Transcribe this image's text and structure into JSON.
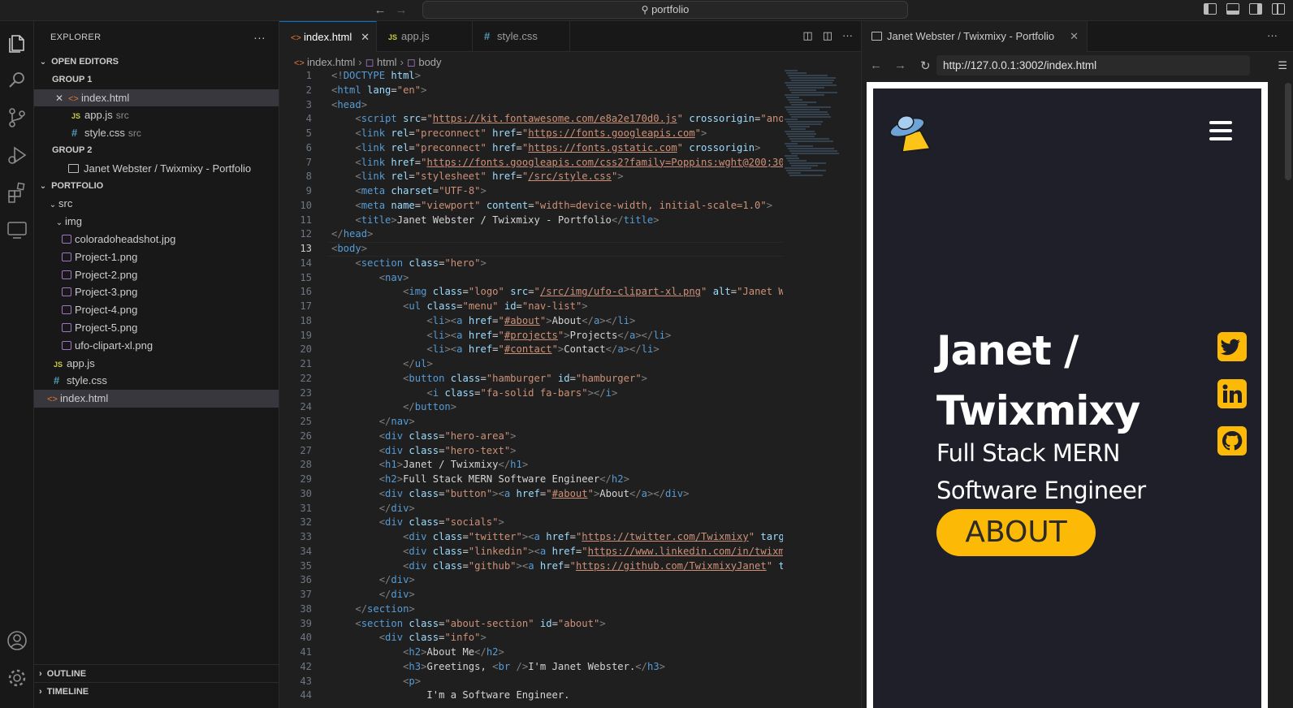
{
  "titlebar": {
    "search_label": "portfolio"
  },
  "explorer": {
    "title": "EXPLORER",
    "more": "···",
    "open_editors_label": "OPEN EDITORS",
    "group1_label": "GROUP 1",
    "group1_items": [
      {
        "name": "index.html",
        "desc": ""
      },
      {
        "name": "app.js",
        "desc": "src"
      },
      {
        "name": "style.css",
        "desc": "src"
      }
    ],
    "group2_label": "GROUP 2",
    "group2_items": [
      {
        "name": "Janet Webster / Twixmixy - Portfolio"
      }
    ],
    "project_label": "PORTFOLIO",
    "folder_src": "src",
    "folder_img": "img",
    "img_files": [
      "coloradoheadshot.jpg",
      "Project-1.png",
      "Project-2.png",
      "Project-3.png",
      "Project-4.png",
      "Project-5.png",
      "ufo-clipart-xl.png"
    ],
    "src_files": [
      "app.js",
      "style.css"
    ],
    "root_files": [
      "index.html"
    ],
    "outline_label": "OUTLINE",
    "timeline_label": "TIMELINE"
  },
  "editor": {
    "tabs": [
      {
        "label": "index.html",
        "active": true
      },
      {
        "label": "app.js",
        "active": false
      },
      {
        "label": "style.css",
        "active": false
      }
    ],
    "breadcrumb": [
      "index.html",
      "html",
      "body"
    ],
    "current_line": 13,
    "lines": [
      "<!DOCTYPE html>",
      "<html lang=\"en\">",
      "<head>",
      "    <script src=\"https://kit.fontawesome.com/e8a2e170d0.js\" crossorigin=\"anony",
      "    <link rel=\"preconnect\" href=\"https://fonts.googleapis.com\">",
      "    <link rel=\"preconnect\" href=\"https://fonts.gstatic.com\" crossorigin>",
      "    <link href=\"https://fonts.googleapis.com/css2?family=Poppins:wght@200;300;",
      "    <link rel=\"stylesheet\" href=\"/src/style.css\">",
      "    <meta charset=\"UTF-8\">",
      "    <meta name=\"viewport\" content=\"width=device-width, initial-scale=1.0\">",
      "    <title>Janet Webster / Twixmixy - Portfolio</title>",
      "</head>",
      "<body>",
      "    <section class=\"hero\">",
      "        <nav>",
      "            <img class=\"logo\" src=\"/src/img/ufo-clipart-xl.png\" alt=\"Janet Web",
      "            <ul class=\"menu\" id=\"nav-list\">",
      "                <li><a href=\"#about\">About</a></li>",
      "                <li><a href=\"#projects\">Projects</a></li>",
      "                <li><a href=\"#contact\">Contact</a></li>",
      "            </ul>",
      "            <button class=\"hamburger\" id=\"hamburger\">",
      "                <i class=\"fa-solid fa-bars\"></i>",
      "            </button>",
      "        </nav>",
      "        <div class=\"hero-area\">",
      "        <div class=\"hero-text\">",
      "        <h1>Janet / Twixmixy</h1>",
      "        <h2>Full Stack MERN Software Engineer</h2>",
      "        <div class=\"button\"><a href=\"#about\">About</a></div>",
      "        </div>",
      "        <div class=\"socials\">",
      "            <div class=\"twitter\"><a href=\"https://twitter.com/Twixmixy\" target",
      "            <div class=\"linkedin\"><a href=\"https://www.linkedin.com/in/twixmix",
      "            <div class=\"github\"><a href=\"https://github.com/TwixmixyJanet\" tar",
      "        </div>",
      "        </div>",
      "    </section>",
      "    <section class=\"about-section\" id=\"about\">",
      "        <div class=\"info\">",
      "            <h2>About Me</h2>",
      "            <h3>Greetings, <br />I'm Janet Webster.</h3>",
      "            <p>",
      "                I'm a Software Engineer."
    ]
  },
  "browser": {
    "tab_title": "Janet Webster / Twixmixy - Portfolio",
    "url": "http://127.0.0.1:3002/index.html",
    "hero_title_line1": "Janet /",
    "hero_title_line2": "Twixmixy",
    "hero_sub_line1": "Full Stack MERN",
    "hero_sub_line2": "Software Engineer",
    "about_button": "ABOUT",
    "accent_color": "#fcb906",
    "page_bg": "#1e1f29",
    "socials": [
      "twitter-icon",
      "linkedin-icon",
      "github-icon"
    ]
  }
}
